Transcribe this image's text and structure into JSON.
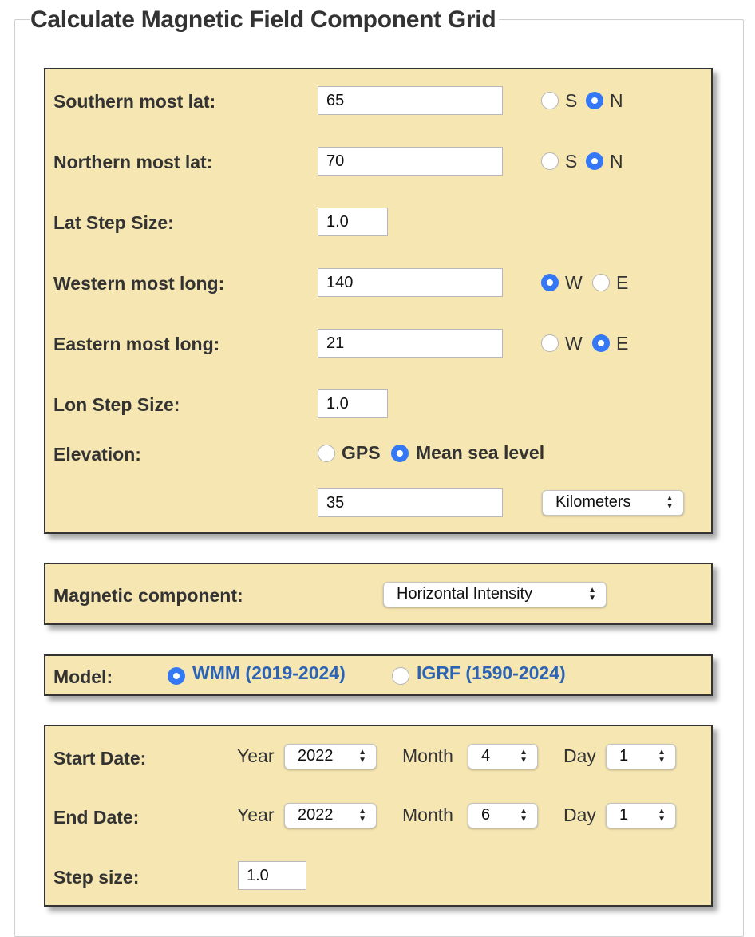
{
  "legend": "Calculate Magnetic Field Component Grid",
  "location": {
    "south_lat": {
      "label": "Southern most lat:",
      "value": "65",
      "opt1": "S",
      "opt2": "N",
      "selected": "N"
    },
    "north_lat": {
      "label": "Northern most lat:",
      "value": "70",
      "opt1": "S",
      "opt2": "N",
      "selected": "N"
    },
    "lat_step": {
      "label": "Lat Step Size:",
      "value": "1.0"
    },
    "west_long": {
      "label": "Western most long:",
      "value": "140",
      "opt1": "W",
      "opt2": "E",
      "selected": "W"
    },
    "east_long": {
      "label": "Eastern most long:",
      "value": "21",
      "opt1": "W",
      "opt2": "E",
      "selected": "E"
    },
    "lon_step": {
      "label": "Lon Step Size:",
      "value": "1.0"
    },
    "elevation": {
      "label": "Elevation:",
      "opt1": "GPS",
      "opt2": "Mean sea level",
      "selected": "Mean sea level",
      "value": "35",
      "unit": "Kilometers"
    }
  },
  "component": {
    "label": "Magnetic component:",
    "value": "Horizontal Intensity"
  },
  "model": {
    "label": "Model:",
    "wmm": "WMM (2019-2024)",
    "igrf": "IGRF (1590-2024)",
    "selected": "WMM"
  },
  "dates": {
    "start": {
      "label": "Start Date:",
      "year_label": "Year",
      "year": "2022",
      "month_label": "Month",
      "month": "4",
      "day_label": "Day",
      "day": "1"
    },
    "end": {
      "label": "End Date:",
      "year_label": "Year",
      "year": "2022",
      "month_label": "Month",
      "month": "6",
      "day_label": "Day",
      "day": "1"
    },
    "step": {
      "label": "Step size:",
      "value": "1.0"
    }
  },
  "colors": {
    "panel_bg": "#f5e6b2",
    "accent": "#3478f6",
    "link": "#2b63b5"
  }
}
